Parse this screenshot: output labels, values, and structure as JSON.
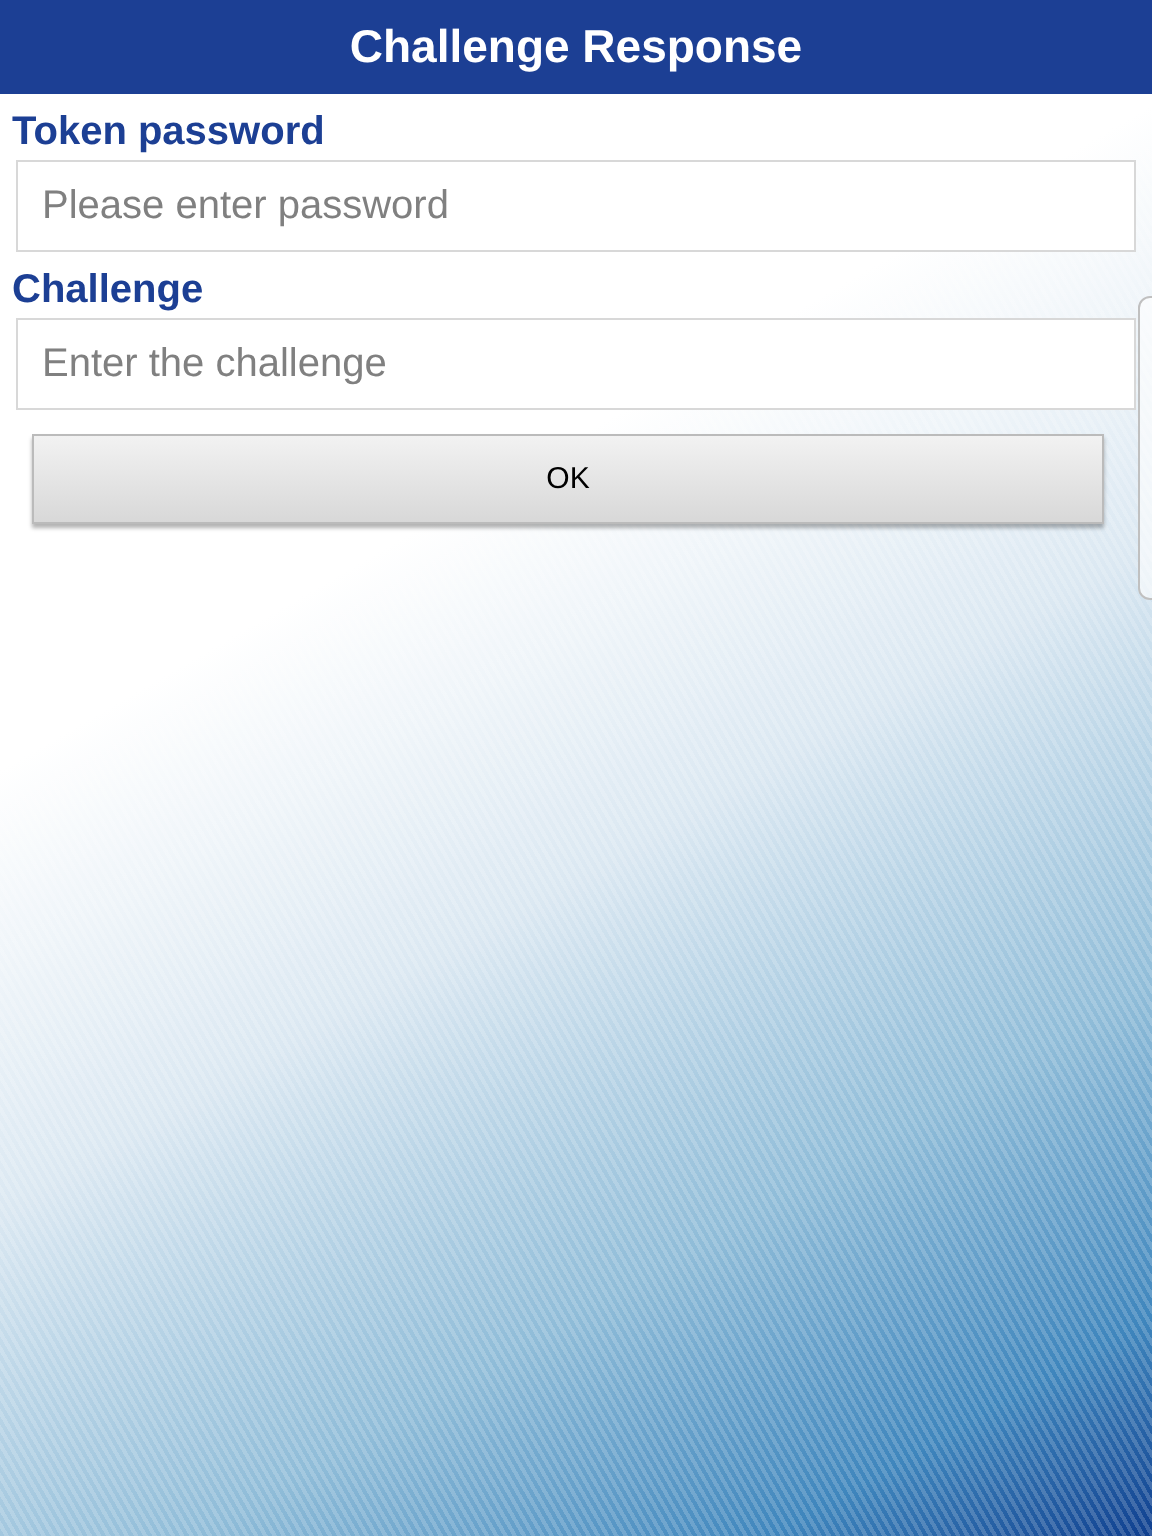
{
  "header": {
    "title": "Challenge Response"
  },
  "fields": [
    {
      "label": "Token password",
      "placeholder": "Please enter password"
    },
    {
      "label": "Challenge",
      "placeholder": "Enter the challenge"
    }
  ],
  "buttons": [
    "OK"
  ]
}
